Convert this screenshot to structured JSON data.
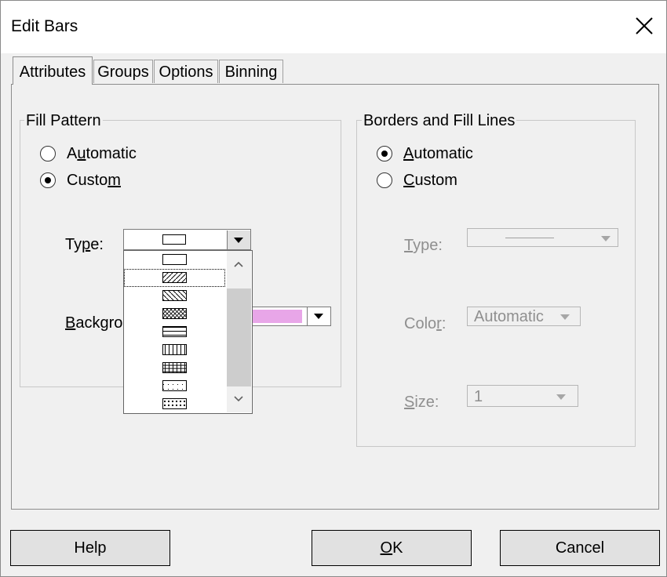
{
  "window": {
    "title": "Edit Bars",
    "close_icon": "close-icon"
  },
  "tabs": [
    {
      "label": "Attributes",
      "active": true
    },
    {
      "label": "Groups"
    },
    {
      "label": "Options"
    },
    {
      "label": "Binning"
    }
  ],
  "fill_pattern": {
    "legend": "Fill Pattern",
    "radio_automatic": {
      "prefix": "A",
      "accel": "u",
      "rest": "tomatic",
      "checked": false
    },
    "radio_custom": {
      "prefix": "Custo",
      "accel": "m",
      "rest": "",
      "checked": true
    },
    "type_label": {
      "prefix": "Ty",
      "accel": "p",
      "rest": "e:"
    },
    "background_label": {
      "prefix": "",
      "accel": "B",
      "rest": "ackgro"
    },
    "background_color": "#e8a6e8",
    "pattern_options": [
      "none",
      "forward-diagonal",
      "backward-diagonal",
      "cross-hatch",
      "horizontal",
      "vertical",
      "grid",
      "dots",
      "dense-dots"
    ],
    "highlighted_option": "forward-diagonal"
  },
  "borders": {
    "legend": "Borders and Fill Lines",
    "radio_automatic": {
      "prefix": "",
      "accel": "A",
      "rest": "utomatic",
      "checked": true
    },
    "radio_custom": {
      "prefix": "",
      "accel": "C",
      "rest": "ustom",
      "checked": false
    },
    "type_label": {
      "prefix": "",
      "accel": "T",
      "rest": "ype:"
    },
    "color_label": {
      "prefix": "Colo",
      "accel": "r",
      "rest": ":"
    },
    "color_value": "Automatic",
    "size_label": {
      "prefix": "",
      "accel": "S",
      "rest": "ize:"
    },
    "size_value": "1"
  },
  "buttons": {
    "help": "Help",
    "ok": {
      "prefix": "",
      "accel": "O",
      "rest": "K"
    },
    "cancel": "Cancel"
  }
}
